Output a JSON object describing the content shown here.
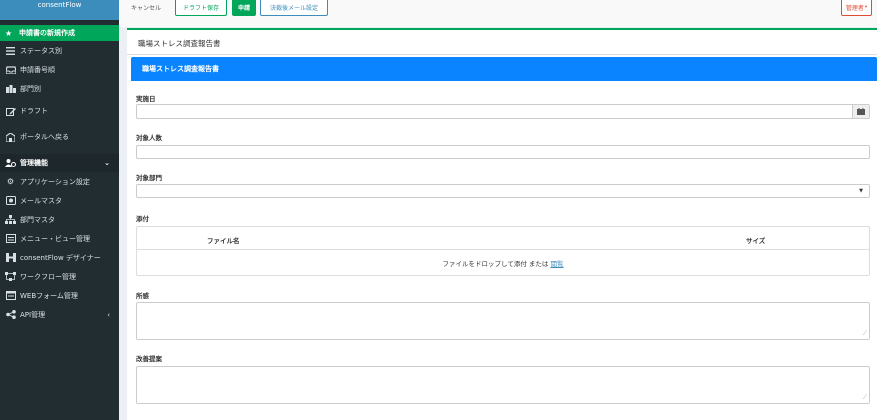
{
  "app": {
    "brand": "consentFlow"
  },
  "sidebar": {
    "new_request": "申請書の新規作成",
    "items": [
      {
        "label": "ステータス別",
        "icon": "list-icon"
      },
      {
        "label": "申請番号順",
        "icon": "inbox-icon"
      },
      {
        "label": "部門別",
        "icon": "building-icon"
      },
      {
        "label": "ドラフト",
        "icon": "edit-icon"
      },
      {
        "label": "ポータルへ戻る",
        "icon": "portal-icon"
      }
    ],
    "admin_header": "管理機能",
    "admin_items": [
      {
        "label": "アプリケーション設定",
        "icon": "gear-icon"
      },
      {
        "label": "メールマスタ",
        "icon": "mail-icon"
      },
      {
        "label": "部門マスタ",
        "icon": "sitemap-icon"
      },
      {
        "label": "メニュー・ビュー管理",
        "icon": "menu-icon"
      },
      {
        "label": "consentFlow デザイナー",
        "icon": "designer-icon"
      },
      {
        "label": "ワークフロー管理",
        "icon": "workflow-icon"
      },
      {
        "label": "WEBフォーム管理",
        "icon": "form-icon"
      },
      {
        "label": "API管理",
        "icon": "share-icon"
      }
    ]
  },
  "toolbar": {
    "cancel": "キャンセル",
    "draft_save": "ドラフト保存",
    "apply": "申請",
    "mail_setting": "決裁後メール設定",
    "admin": "管理者"
  },
  "page": {
    "title": "職場ストレス調査報告書",
    "panel_title": "職場ストレス調査報告書"
  },
  "form": {
    "date_label": "実施日",
    "date_value": "",
    "count_label": "対象人数",
    "count_value": "",
    "dept_label": "対象部門",
    "dept_value": "",
    "attach_label": "添付",
    "col_filename": "ファイル名",
    "col_size": "サイズ",
    "drop_text": "ファイルをドロップして添付 または",
    "browse": "閲覧",
    "remarks_label": "所感",
    "remarks_value": "",
    "proposal_label": "改善提案",
    "proposal_value": ""
  },
  "colors": {
    "sidebar_bg": "#222d32",
    "brand_bg": "#3c8dbc",
    "accent_green": "#00a65a",
    "panel_blue": "#0a84ff",
    "admin_red": "#dd4b39"
  }
}
